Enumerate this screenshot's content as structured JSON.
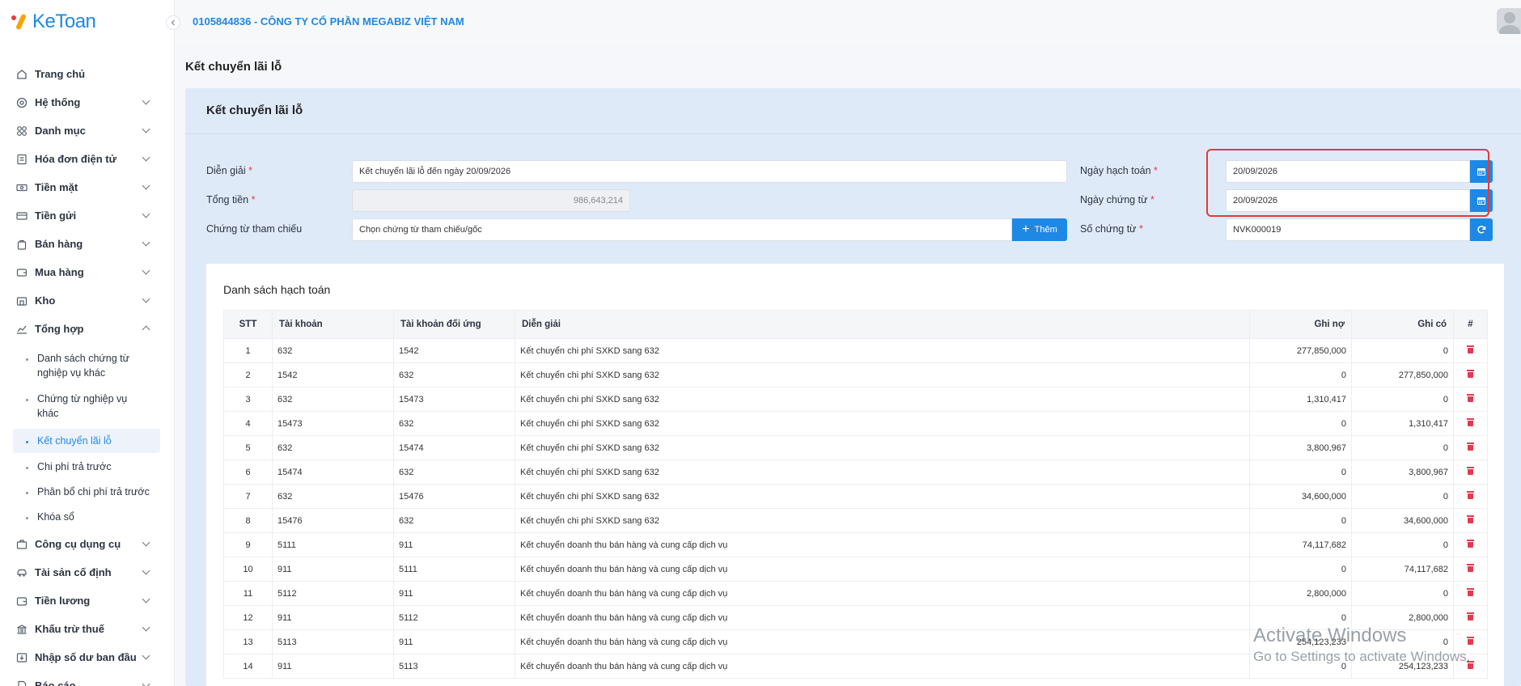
{
  "app": {
    "logo_text": "KeToan",
    "company": "0105844836 - CÔNG TY CỔ PHẦN MEGABIZ VIỆT NAM"
  },
  "sidebar": {
    "items": [
      {
        "label": "Trang chủ",
        "icon": "home-icon"
      },
      {
        "label": "Hệ thống",
        "icon": "gear-icon"
      },
      {
        "label": "Danh mục",
        "icon": "grid-icon"
      },
      {
        "label": "Hóa đơn điện tử",
        "icon": "invoice-icon"
      },
      {
        "label": "Tiền mặt",
        "icon": "cash-icon"
      },
      {
        "label": "Tiền gửi",
        "icon": "card-icon"
      },
      {
        "label": "Bán hàng",
        "icon": "bag-icon"
      },
      {
        "label": "Mua hàng",
        "icon": "cart-icon"
      },
      {
        "label": "Kho",
        "icon": "warehouse-icon"
      },
      {
        "label": "Tổng hợp",
        "icon": "chart-icon"
      }
    ],
    "sub_items": [
      {
        "label": "Danh sách chứng từ nghiệp vụ khác"
      },
      {
        "label": "Chứng từ nghiệp vụ khác"
      },
      {
        "label": "Kết chuyển lãi lỗ"
      },
      {
        "label": "Chi phí trả trước"
      },
      {
        "label": "Phân bổ chi phí trả trước"
      },
      {
        "label": "Khóa sổ"
      }
    ],
    "items_after": [
      {
        "label": "Công cụ dụng cụ",
        "icon": "tools-icon"
      },
      {
        "label": "Tài sản cố định",
        "icon": "car-icon"
      },
      {
        "label": "Tiền lương",
        "icon": "wallet-icon"
      },
      {
        "label": "Khấu trừ thuế",
        "icon": "bank-icon"
      },
      {
        "label": "Nhập số dư ban đầu",
        "icon": "import-icon"
      },
      {
        "label": "Báo cáo",
        "icon": "report-icon"
      }
    ]
  },
  "page": {
    "title": "Kết chuyển lãi lỗ",
    "panel_title": "Kết chuyển lãi lỗ"
  },
  "form": {
    "dien_giai_label": "Diễn giải",
    "dien_giai_value": "Kết chuyển lãi lỗ đến ngày 20/09/2026",
    "tong_tien_label": "Tổng tiền",
    "tong_tien_value": "986,643,214",
    "chung_tu_label": "Chứng từ tham chiếu",
    "chung_tu_placeholder": "Chọn chứng từ tham chiếu/gốc",
    "add_label": "Thêm",
    "ngay_hach_toan_label": "Ngày hạch toán",
    "ngay_hach_toan_value": "20/09/2026",
    "ngay_chung_tu_label": "Ngày chứng từ",
    "ngay_chung_tu_value": "20/09/2026",
    "so_chung_tu_label": "Số chứng từ",
    "so_chung_tu_value": "NVK000019",
    "required_mark": "*"
  },
  "table": {
    "title": "Danh sách hạch toán",
    "headers": [
      "STT",
      "Tài khoản",
      "Tài khoản đối ứng",
      "Diễn giải",
      "Ghi nợ",
      "Ghi có",
      "#"
    ],
    "rows": [
      [
        "1",
        "632",
        "1542",
        "Kết chuyển chi phí SXKD sang 632",
        "277,850,000",
        "0"
      ],
      [
        "2",
        "1542",
        "632",
        "Kết chuyển chi phí SXKD sang 632",
        "0",
        "277,850,000"
      ],
      [
        "3",
        "632",
        "15473",
        "Kết chuyển chi phí SXKD sang 632",
        "1,310,417",
        "0"
      ],
      [
        "4",
        "15473",
        "632",
        "Kết chuyển chi phí SXKD sang 632",
        "0",
        "1,310,417"
      ],
      [
        "5",
        "632",
        "15474",
        "Kết chuyển chi phí SXKD sang 632",
        "3,800,967",
        "0"
      ],
      [
        "6",
        "15474",
        "632",
        "Kết chuyển chi phí SXKD sang 632",
        "0",
        "3,800,967"
      ],
      [
        "7",
        "632",
        "15476",
        "Kết chuyển chi phí SXKD sang 632",
        "34,600,000",
        "0"
      ],
      [
        "8",
        "15476",
        "632",
        "Kết chuyển chi phí SXKD sang 632",
        "0",
        "34,600,000"
      ],
      [
        "9",
        "5111",
        "911",
        "Kết chuyển doanh thu bán hàng và cung cấp dịch vụ",
        "74,117,682",
        "0"
      ],
      [
        "10",
        "911",
        "5111",
        "Kết chuyển doanh thu bán hàng và cung cấp dịch vụ",
        "0",
        "74,117,682"
      ],
      [
        "11",
        "5112",
        "911",
        "Kết chuyển doanh thu bán hàng và cung cấp dịch vụ",
        "2,800,000",
        "0"
      ],
      [
        "12",
        "911",
        "5112",
        "Kết chuyển doanh thu bán hàng và cung cấp dịch vụ",
        "0",
        "2,800,000"
      ],
      [
        "13",
        "5113",
        "911",
        "Kết chuyển doanh thu bán hàng và cung cấp dịch vụ",
        "254,123,233",
        "0"
      ],
      [
        "14",
        "911",
        "5113",
        "Kết chuyển doanh thu bán hàng và cung cấp dịch vụ",
        "0",
        "254,123,233"
      ]
    ]
  },
  "watermark": {
    "line1": "Activate Windows",
    "line2": "Go to Settings to activate Windows."
  },
  "colors": {
    "accent": "#1e88e5",
    "danger": "#e53935",
    "panel_bg": "#dfeaf9"
  }
}
